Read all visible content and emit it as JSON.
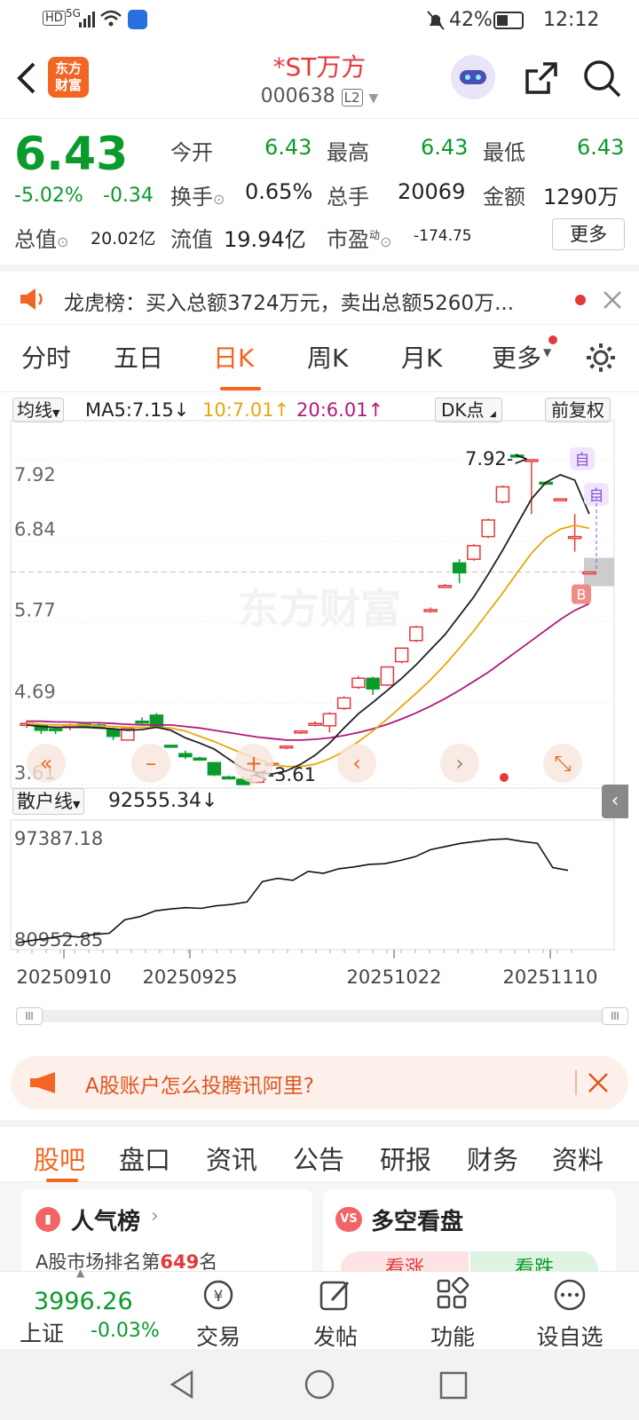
{
  "status": {
    "battery": "42%",
    "time": "12:12",
    "network": "5G"
  },
  "header": {
    "title": "*ST万方",
    "code": "000638",
    "level": "L2",
    "logo_text": [
      "东方",
      "财富"
    ]
  },
  "quote": {
    "price": "6.43",
    "change_pct": "-5.02%",
    "change": "-0.34",
    "open_label": "今开",
    "open": "6.43",
    "high_label": "最高",
    "high": "6.43",
    "low_label": "最低",
    "low": "6.43",
    "turnover_label": "换手",
    "turnover": "0.65%",
    "volume_label": "总手",
    "volume": "20069",
    "amount_label": "金额",
    "amount": "1290万",
    "mktcap_label": "总值",
    "mktcap": "20.02亿",
    "float_label": "流值",
    "float_cap": "19.94亿",
    "pe_label": "市盈",
    "pe_sup": "动",
    "pe": "-174.75",
    "more_label": "更多"
  },
  "notice": {
    "text": "龙虎榜：买入总额3724万元，卖出总额5260万..."
  },
  "ktabs": {
    "items": [
      "分时",
      "五日",
      "日K",
      "周K",
      "月K",
      "更多"
    ],
    "active": "日K"
  },
  "chart_bar": {
    "ma_select": "均线",
    "ma5": "MA5:7.15↓",
    "ma10": "10:7.01↑",
    "ma20": "20:6.01↑",
    "dk": "DK点",
    "fq": "前复权"
  },
  "chart_data": {
    "type": "candlestick",
    "y_ticks": [
      "7.92",
      "6.84",
      "5.77",
      "4.69",
      "3.61"
    ],
    "ylim": [
      3.61,
      7.92
    ],
    "high_marker": "7.92->",
    "low_marker": "<-3.61",
    "watermark": "东方财富",
    "markers": [
      "自",
      "自",
      "B"
    ],
    "candles": [
      {
        "o": 4.4,
        "c": 4.42,
        "h": 4.46,
        "l": 4.36
      },
      {
        "o": 4.4,
        "c": 4.33,
        "h": 4.4,
        "l": 4.28
      },
      {
        "o": 4.35,
        "c": 4.33,
        "h": 4.38,
        "l": 4.28
      },
      {
        "o": 4.38,
        "c": 4.4,
        "h": 4.42,
        "l": 4.33
      },
      {
        "o": 4.41,
        "c": 4.37,
        "h": 4.42,
        "l": 4.36
      },
      {
        "o": 4.4,
        "c": 4.38,
        "h": 4.42,
        "l": 4.36
      },
      {
        "o": 4.34,
        "c": 4.25,
        "h": 4.36,
        "l": 4.2
      },
      {
        "o": 4.2,
        "c": 4.35,
        "h": 4.36,
        "l": 4.2
      },
      {
        "o": 4.45,
        "c": 4.44,
        "h": 4.5,
        "l": 4.4
      },
      {
        "o": 4.53,
        "c": 4.37,
        "h": 4.56,
        "l": 4.36
      },
      {
        "o": 4.13,
        "c": 4.12,
        "h": 4.14,
        "l": 4.1
      },
      {
        "o": 4.02,
        "c": 3.98,
        "h": 4.06,
        "l": 3.95
      },
      {
        "o": 3.96,
        "c": 3.95,
        "h": 3.98,
        "l": 3.93
      },
      {
        "o": 3.9,
        "c": 3.74,
        "h": 3.91,
        "l": 3.72
      },
      {
        "o": 3.71,
        "c": 3.7,
        "h": 3.73,
        "l": 3.68
      },
      {
        "o": 3.68,
        "c": 3.61,
        "h": 3.72,
        "l": 3.61
      },
      {
        "o": 3.64,
        "c": 3.73,
        "h": 3.77,
        "l": 3.63
      },
      {
        "o": 3.87,
        "c": 3.89,
        "h": 3.92,
        "l": 3.86
      },
      {
        "o": 4.1,
        "c": 4.12,
        "h": 4.13,
        "l": 4.08
      },
      {
        "o": 4.3,
        "c": 4.32,
        "h": 4.33,
        "l": 4.28
      },
      {
        "o": 4.4,
        "c": 4.42,
        "h": 4.45,
        "l": 4.38
      },
      {
        "o": 4.39,
        "c": 4.55,
        "h": 4.57,
        "l": 4.3
      },
      {
        "o": 4.62,
        "c": 4.76,
        "h": 4.78,
        "l": 4.6
      },
      {
        "o": 4.9,
        "c": 5.02,
        "h": 5.05,
        "l": 4.88
      },
      {
        "o": 5.02,
        "c": 4.88,
        "h": 5.04,
        "l": 4.8
      },
      {
        "o": 4.93,
        "c": 5.17,
        "h": 5.18,
        "l": 4.92
      },
      {
        "o": 5.24,
        "c": 5.42,
        "h": 5.43,
        "l": 5.22
      },
      {
        "o": 5.52,
        "c": 5.7,
        "h": 5.72,
        "l": 5.5
      },
      {
        "o": 5.91,
        "c": 5.93,
        "h": 5.96,
        "l": 5.89
      },
      {
        "o": 6.23,
        "c": 6.25,
        "h": 6.27,
        "l": 6.22
      },
      {
        "o": 6.55,
        "c": 6.42,
        "h": 6.6,
        "l": 6.28
      },
      {
        "o": 6.6,
        "c": 6.78,
        "h": 6.8,
        "l": 6.58
      },
      {
        "o": 6.9,
        "c": 7.12,
        "h": 7.14,
        "l": 6.88
      },
      {
        "o": 7.36,
        "c": 7.56,
        "h": 7.58,
        "l": 7.34
      },
      {
        "o": 7.98,
        "c": 7.97,
        "h": 8.0,
        "l": 7.95
      },
      {
        "o": 7.92,
        "c": 7.92,
        "h": 7.92,
        "l": 7.2
      },
      {
        "o": 7.62,
        "c": 7.61,
        "h": 7.63,
        "l": 7.6
      },
      {
        "o": 7.4,
        "c": 7.4,
        "h": 7.4,
        "l": 7.4
      },
      {
        "o": 6.9,
        "c": 6.9,
        "h": 7.2,
        "l": 6.7
      },
      {
        "o": 6.43,
        "c": 6.43,
        "h": 6.43,
        "l": 6.43
      }
    ],
    "ma5": [
      4.4,
      4.38,
      4.37,
      4.37,
      4.37,
      4.36,
      4.35,
      4.33,
      4.34,
      4.37,
      4.33,
      4.23,
      4.16,
      4.08,
      3.95,
      3.82,
      3.77,
      3.75,
      3.79,
      3.88,
      4.0,
      4.16,
      4.36,
      4.55,
      4.7,
      4.86,
      5.02,
      5.2,
      5.4,
      5.6,
      5.85,
      6.1,
      6.4,
      6.72,
      7.06,
      7.4,
      7.62,
      7.72,
      7.65,
      7.2
    ],
    "ma10": [
      4.42,
      4.41,
      4.4,
      4.4,
      4.4,
      4.39,
      4.38,
      4.37,
      4.37,
      4.37,
      4.36,
      4.32,
      4.25,
      4.18,
      4.1,
      4.02,
      3.95,
      3.88,
      3.85,
      3.85,
      3.88,
      3.95,
      4.05,
      4.18,
      4.32,
      4.48,
      4.65,
      4.82,
      5.0,
      5.2,
      5.42,
      5.65,
      5.9,
      6.15,
      6.42,
      6.68,
      6.88,
      7.0,
      7.05,
      7.01
    ],
    "ma20": [
      4.45,
      4.45,
      4.44,
      4.44,
      4.43,
      4.43,
      4.42,
      4.41,
      4.4,
      4.4,
      4.4,
      4.38,
      4.36,
      4.33,
      4.3,
      4.27,
      4.24,
      4.22,
      4.2,
      4.2,
      4.21,
      4.23,
      4.26,
      4.3,
      4.35,
      4.41,
      4.48,
      4.56,
      4.65,
      4.75,
      4.86,
      4.98,
      5.1,
      5.24,
      5.38,
      5.52,
      5.66,
      5.8,
      5.92,
      6.01
    ],
    "dashed_price": 6.43
  },
  "sub_chart": {
    "select": "散户线",
    "value": "92555.34↓",
    "top": "97387.18",
    "bottom": "80952.85",
    "series": [
      81200,
      81600,
      81900,
      82300,
      82100,
      82500,
      82700,
      84800,
      85300,
      86200,
      86500,
      86700,
      86600,
      87000,
      87200,
      87600,
      90800,
      91300,
      91000,
      92400,
      92100,
      92800,
      93100,
      93500,
      93600,
      94100,
      94700,
      95800,
      96300,
      96800,
      97100,
      97400,
      97500,
      97100,
      96800,
      93000,
      92550
    ],
    "dates": [
      "20250910",
      "20250925",
      "20251022",
      "20251110"
    ]
  },
  "ad": {
    "text": "A股账户怎么投腾讯阿里?"
  },
  "btabs": {
    "items": [
      "股吧",
      "盘口",
      "资讯",
      "公告",
      "研报",
      "财务",
      "资料"
    ],
    "active": "股吧"
  },
  "cards": {
    "left_title": "人气榜",
    "left_sub_pre": "A股市场排名第",
    "left_rank": "649",
    "left_sub_post": "名",
    "right_title": "多空看盘",
    "bull": "看涨",
    "bear": "看跌"
  },
  "bottom": {
    "index_value": "3996.26",
    "index_name": "上证",
    "index_change": "-0.03%",
    "nav": [
      "交易",
      "发帖",
      "功能",
      "设自选"
    ]
  }
}
